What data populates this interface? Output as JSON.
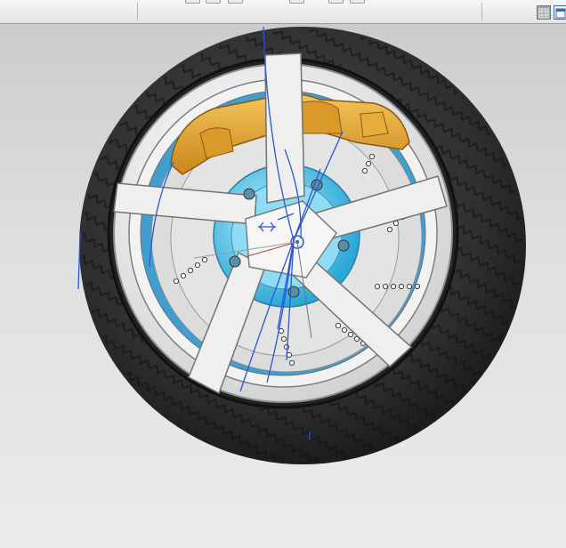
{
  "toolbar": {
    "icons": [
      "grid-view-icon",
      "window-icon"
    ]
  },
  "viewport": {
    "model": "wheel-assembly",
    "colors": {
      "background_top": "#c9cacc",
      "background_bottom": "#eaebed",
      "tire": "#2b2c2e",
      "rim": "#eeeeee",
      "hub": "#5ec8ea",
      "caliper": "#e2a432",
      "sketch_lines": "#2a57d8",
      "disc_holes": "#444444"
    }
  }
}
